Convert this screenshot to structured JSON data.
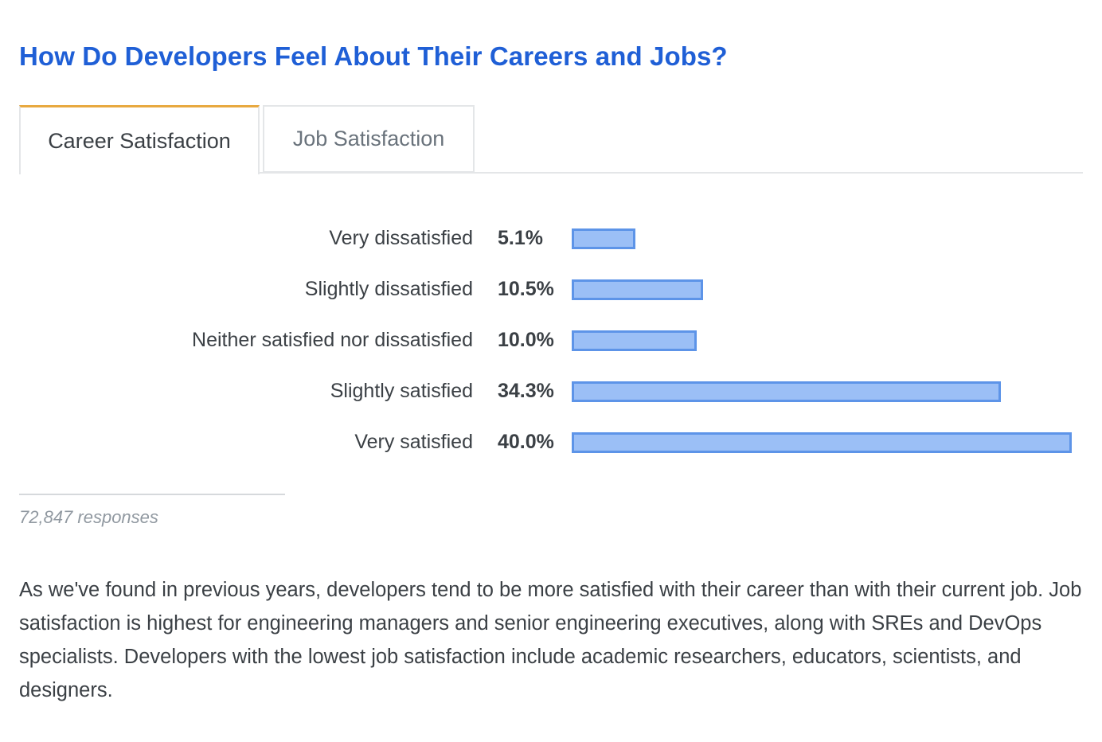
{
  "page": {
    "title": "How Do Developers Feel About Their Careers and Jobs?"
  },
  "tabs": [
    {
      "label": "Career Satisfaction",
      "active": true
    },
    {
      "label": "Job Satisfaction",
      "active": false
    }
  ],
  "colors": {
    "title": "#1f5fd6",
    "active_tab_accent": "#e8a940",
    "bar_fill": "#9bbff6",
    "bar_border": "#5d94e8"
  },
  "chart_data": {
    "type": "bar",
    "orientation": "horizontal",
    "categories": [
      "Very dissatisfied",
      "Slightly dissatisfied",
      "Neither satisfied nor dissatisfied",
      "Slightly satisfied",
      "Very satisfied"
    ],
    "values": [
      5.1,
      10.5,
      10.0,
      34.3,
      40.0
    ],
    "value_labels": [
      "5.1%",
      "10.5%",
      "10.0%",
      "34.3%",
      "40.0%"
    ],
    "grid": false
  },
  "footnote": {
    "responses": "72,847 responses"
  },
  "body": {
    "paragraph": "As we've found in previous years, developers tend to be more satisfied with their career than with their current job. Job satisfaction is highest for engineering managers and senior engineering executives, along with SREs and DevOps specialists. Developers with the lowest job satisfaction include academic researchers, educators, scientists, and designers."
  }
}
